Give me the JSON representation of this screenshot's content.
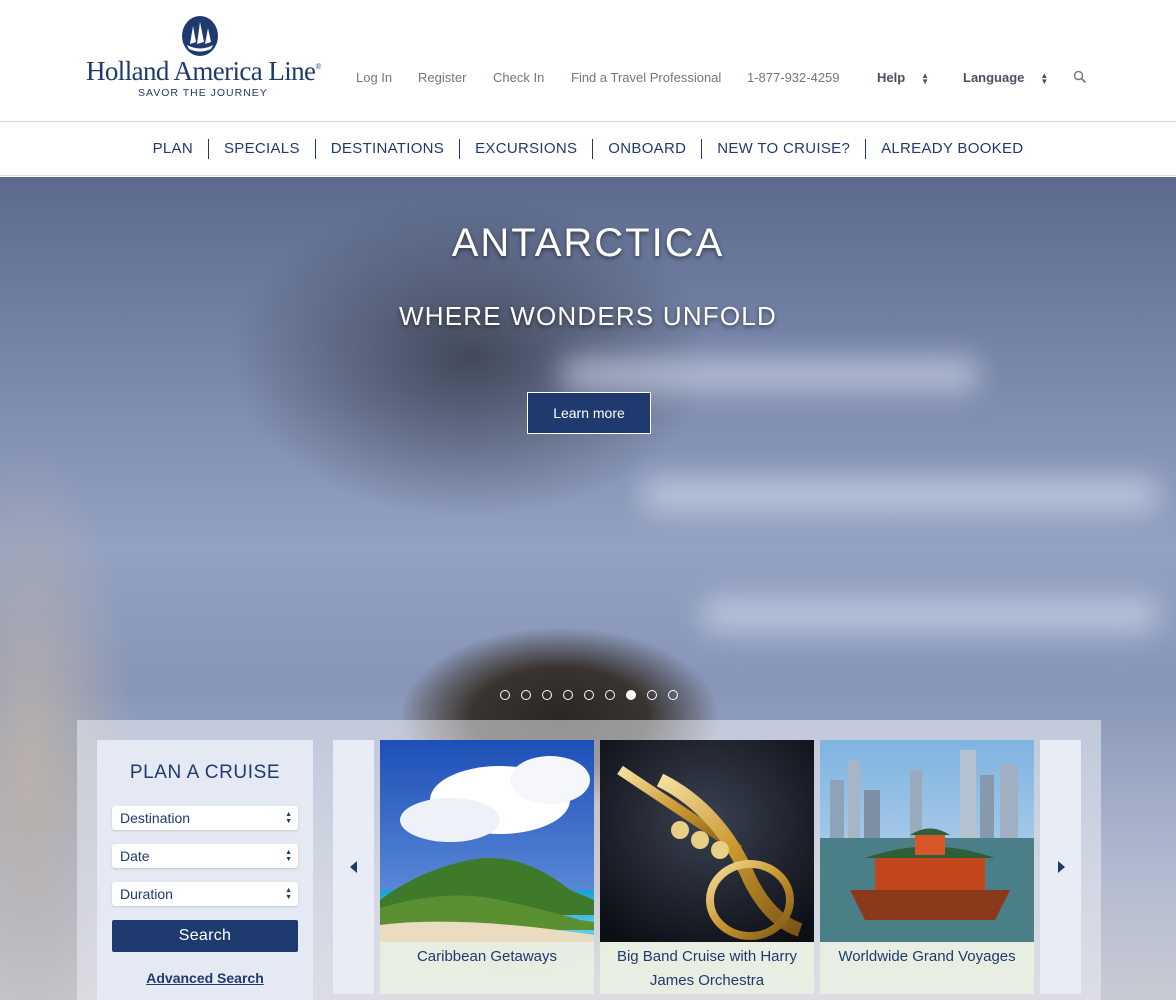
{
  "brand": {
    "name": "Holland America Line",
    "reg": "®",
    "tagline": "SAVOR THE JOURNEY"
  },
  "utility": {
    "login": "Log In",
    "register": "Register",
    "checkin": "Check In",
    "travel_pro": "Find a Travel Professional",
    "phone": "1-877-932-4259",
    "help": "Help",
    "language": "Language"
  },
  "nav": [
    "PLAN",
    "SPECIALS",
    "DESTINATIONS",
    "EXCURSIONS",
    "ONBOARD",
    "NEW TO CRUISE?",
    "ALREADY BOOKED"
  ],
  "hero": {
    "title": "ANTARCTICA",
    "subtitle": "WHERE WONDERS UNFOLD",
    "cta": "Learn more",
    "slide_count": 9,
    "active_slide": 7
  },
  "plan": {
    "title": "PLAN A CRUISE",
    "destination": "Destination",
    "date": "Date",
    "duration": "Duration",
    "search": "Search",
    "advanced": "Advanced Search"
  },
  "cards": [
    {
      "caption": "Caribbean Getaways"
    },
    {
      "caption": "Big Band Cruise with Harry James Orchestra"
    },
    {
      "caption": "Worldwide Grand Voyages"
    }
  ],
  "colors": {
    "brand_navy": "#1f3a6e",
    "panel_blue": "#e5e9f3"
  }
}
